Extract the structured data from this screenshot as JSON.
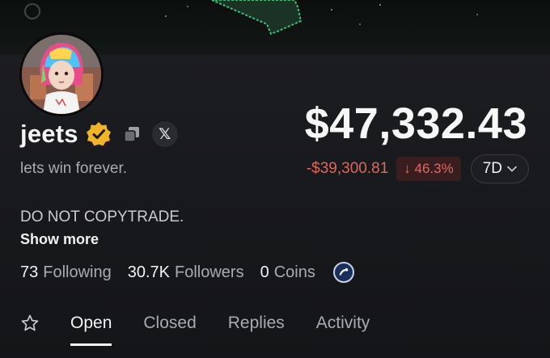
{
  "profile": {
    "name": "jeets",
    "bio": "lets win forever.",
    "description": "DO NOT COPYTRADE.",
    "show_more": "Show more",
    "social_icon": "x-icon",
    "x_glyph": "𝕏"
  },
  "stats": {
    "following_count": "73",
    "following_label": "Following",
    "followers_count": "30.7K",
    "followers_label": "Followers",
    "coins_count": "0",
    "coins_label": "Coins"
  },
  "portfolio": {
    "balance": "$47,332.43",
    "pnl": "-$39,300.81",
    "pct_change": "↓ 46.3%",
    "period": "7D"
  },
  "tabs": [
    {
      "label": "Open",
      "active": true
    },
    {
      "label": "Closed",
      "active": false
    },
    {
      "label": "Replies",
      "active": false
    },
    {
      "label": "Activity",
      "active": false
    }
  ],
  "colors": {
    "negative": "#e0675c",
    "verified": "#f0b429",
    "background": "#16171a"
  }
}
